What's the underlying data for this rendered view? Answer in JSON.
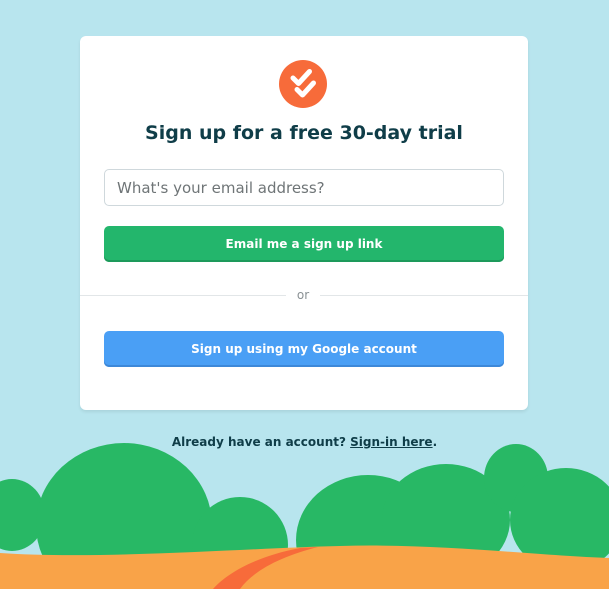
{
  "signup": {
    "heading": "Sign up for a free 30-day trial",
    "email_placeholder": "What's your email address?",
    "email_value": "",
    "email_button_label": "Email me a sign up link",
    "divider_label": "or",
    "google_button_label": "Sign up using my Google account"
  },
  "footer": {
    "prompt": "Already have an account? ",
    "signin_link": "Sign-in here",
    "suffix": "."
  },
  "icons": {
    "logo": "double-check-icon"
  },
  "colors": {
    "background_sky": "#b8e5ee",
    "logo_orange": "#f76b3a",
    "heading_text": "#0f3d48",
    "email_button": "#23b66c",
    "google_button": "#4a9ff5",
    "hills_green": "#28b865",
    "ground_orange": "#f9a348",
    "path_orange": "#f76b3a"
  }
}
